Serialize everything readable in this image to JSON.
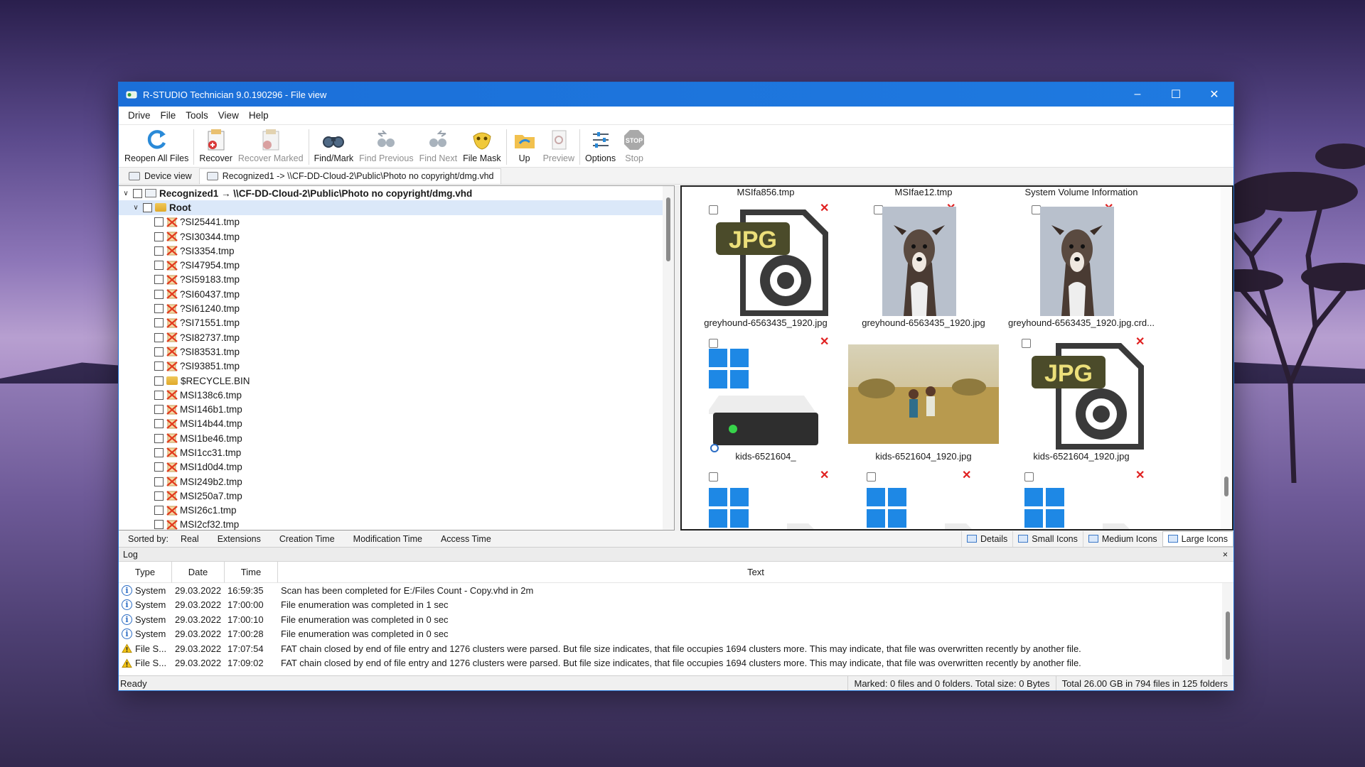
{
  "window": {
    "title": "R-STUDIO Technician 9.0.190296 - File view"
  },
  "menu": [
    "Drive",
    "File",
    "Tools",
    "View",
    "Help"
  ],
  "toolbar": [
    {
      "label": "Reopen All Files",
      "icon": "reopen-icon",
      "enabled": true
    },
    {
      "label": "Recover",
      "icon": "recover-icon",
      "enabled": true
    },
    {
      "label": "Recover Marked",
      "icon": "recover-marked-icon",
      "enabled": false
    },
    {
      "label": "Find/Mark",
      "icon": "binoculars-icon",
      "enabled": true
    },
    {
      "label": "Find Previous",
      "icon": "find-previous-icon",
      "enabled": false
    },
    {
      "label": "Find Next",
      "icon": "find-next-icon",
      "enabled": false
    },
    {
      "label": "File Mask",
      "icon": "file-mask-icon",
      "enabled": true
    },
    {
      "label": "Up",
      "icon": "folder-up-icon",
      "enabled": true
    },
    {
      "label": "Preview",
      "icon": "preview-icon",
      "enabled": false
    },
    {
      "label": "Options",
      "icon": "options-icon",
      "enabled": true
    },
    {
      "label": "Stop",
      "icon": "stop-icon",
      "enabled": false
    }
  ],
  "tabs": [
    {
      "label": "Device view"
    },
    {
      "label": "Recognized1 -> \\\\CF-DD-Cloud-2\\Public\\Photo no copyright/dmg.vhd"
    }
  ],
  "tree": {
    "root_label": "Recognized1 → \\\\CF-DD-Cloud-2\\Public\\Photo no copyright/dmg.vhd",
    "folder_label": "Root",
    "items": [
      {
        "name": "?SI25441.tmp",
        "type": "deleted"
      },
      {
        "name": "?SI30344.tmp",
        "type": "deleted"
      },
      {
        "name": "?SI3354.tmp",
        "type": "deleted"
      },
      {
        "name": "?SI47954.tmp",
        "type": "deleted"
      },
      {
        "name": "?SI59183.tmp",
        "type": "deleted"
      },
      {
        "name": "?SI60437.tmp",
        "type": "deleted"
      },
      {
        "name": "?SI61240.tmp",
        "type": "deleted"
      },
      {
        "name": "?SI71551.tmp",
        "type": "deleted"
      },
      {
        "name": "?SI82737.tmp",
        "type": "deleted"
      },
      {
        "name": "?SI83531.tmp",
        "type": "deleted"
      },
      {
        "name": "?SI93851.tmp",
        "type": "deleted"
      },
      {
        "name": "$RECYCLE.BIN",
        "type": "folder"
      },
      {
        "name": "MSI138c6.tmp",
        "type": "deleted"
      },
      {
        "name": "MSI146b1.tmp",
        "type": "deleted"
      },
      {
        "name": "MSI14b44.tmp",
        "type": "deleted"
      },
      {
        "name": "MSI1be46.tmp",
        "type": "deleted"
      },
      {
        "name": "MSI1cc31.tmp",
        "type": "deleted"
      },
      {
        "name": "MSI1d0d4.tmp",
        "type": "deleted"
      },
      {
        "name": "MSI249b2.tmp",
        "type": "deleted"
      },
      {
        "name": "MSI250a7.tmp",
        "type": "deleted"
      },
      {
        "name": "MSI26c1.tmp",
        "type": "deleted"
      },
      {
        "name": "MSI2cf32.tmp",
        "type": "deleted"
      }
    ]
  },
  "icon_view": {
    "top_labels": [
      "MSIfa856.tmp",
      "MSIfae12.tmp",
      "System Volume Information"
    ],
    "row1": [
      {
        "name": "greyhound-6563435_1920.jpg",
        "thumb": "jpg-doc-icon"
      },
      {
        "name": "greyhound-6563435_1920.jpg",
        "thumb": "dog-photo"
      },
      {
        "name": "greyhound-6563435_1920.jpg.crd...",
        "thumb": "dog-photo"
      }
    ],
    "row2": [
      {
        "name": "kids-6521604_",
        "thumb": "drive-icon"
      },
      {
        "name": "kids-6521604_1920.jpg",
        "thumb": "kids-photo"
      },
      {
        "name": "kids-6521604_1920.jpg",
        "thumb": "jpg-doc-icon"
      }
    ]
  },
  "sortbar": {
    "label": "Sorted by:",
    "options": [
      "Real",
      "Extensions",
      "Creation Time",
      "Modification Time",
      "Access Time"
    ],
    "views": [
      "Details",
      "Small Icons",
      "Medium Icons",
      "Large Icons"
    ],
    "active_view": "Large Icons"
  },
  "log": {
    "title": "Log",
    "close": "×",
    "columns": [
      "Type",
      "Date",
      "Time",
      "Text"
    ],
    "rows": [
      {
        "icon": "info",
        "type": "System",
        "date": "29.03.2022",
        "time": "16:59:35",
        "text": "Scan has been completed for E:/Files Count - Copy.vhd in 2m"
      },
      {
        "icon": "info",
        "type": "System",
        "date": "29.03.2022",
        "time": "17:00:00",
        "text": "File enumeration was completed in 1 sec"
      },
      {
        "icon": "info",
        "type": "System",
        "date": "29.03.2022",
        "time": "17:00:10",
        "text": "File enumeration was completed in 0 sec"
      },
      {
        "icon": "info",
        "type": "System",
        "date": "29.03.2022",
        "time": "17:00:28",
        "text": "File enumeration was completed in 0 sec"
      },
      {
        "icon": "warning",
        "type": "File S...",
        "date": "29.03.2022",
        "time": "17:07:54",
        "text": "FAT chain closed by end of file entry and 1276 clusters were parsed. But file size indicates, that file occupies 1694 clusters more.  This may indicate, that file was overwritten recently by another file."
      },
      {
        "icon": "warning",
        "type": "File S...",
        "date": "29.03.2022",
        "time": "17:09:02",
        "text": "FAT chain closed by end of file entry and 1276 clusters were parsed. But file size indicates, that file occupies 1694 clusters more.  This may indicate, that file was overwritten recently by another file."
      }
    ]
  },
  "status": {
    "ready": "Ready",
    "marked": "Marked: 0 files and 0 folders. Total size: 0 Bytes",
    "total": "Total 26.00 GB in 794 files in 125 folders"
  },
  "colors": {
    "titlebar": "#1b6fd8",
    "selection": "#dbe8f9",
    "deleted_mark": "#e02020",
    "accent": "#2b6cc4"
  }
}
